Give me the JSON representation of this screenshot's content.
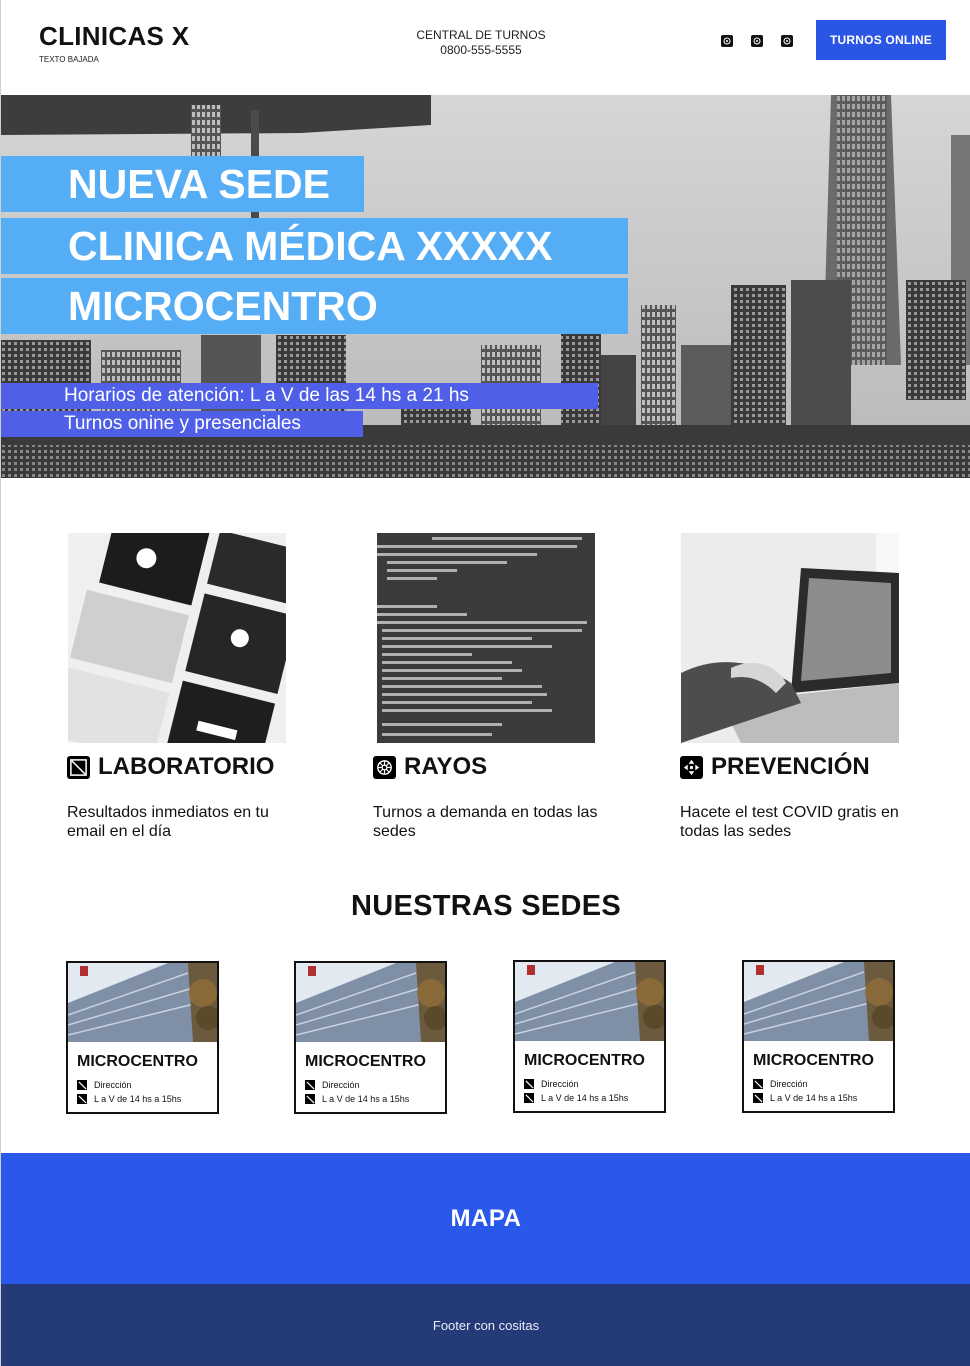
{
  "header": {
    "brand": "CLINICAS X",
    "tagline": "TEXTO BAJADA",
    "central_label": "CENTRAL DE TURNOS",
    "central_phone": "0800-555-5555",
    "social_icons": [
      "social-icon",
      "social-icon",
      "social-icon"
    ],
    "cta_label": "TURNOS ONLINE",
    "cta_color": "#2a55e5"
  },
  "hero": {
    "line1": "NUEVA SEDE",
    "line2": "CLINICA MÉDICA XXXXX",
    "line3": "MICROCENTRO",
    "hours": "Horarios de atención: L a V de las 14 hs a 21 hs",
    "turnos": "Turnos onine y presenciales",
    "band_color": "#55adf6",
    "sub_band_color": "#4f5fe8"
  },
  "services": [
    {
      "title": "LABORATORIO",
      "desc": "Resultados inmediatos en tu email en el día",
      "icon": "slash-square-icon"
    },
    {
      "title": "RAYOS",
      "desc": "Turnos a demanda en todas las sedes",
      "icon": "aperture-icon"
    },
    {
      "title": "PREVENCIÓN",
      "desc": "Hacete el test COVID gratis en todas las sedes",
      "icon": "move-arrows-icon"
    }
  ],
  "sedes": {
    "title": "NUESTRAS SEDES",
    "cards": [
      {
        "name": "MICROCENTRO",
        "address": "Dirección",
        "hours": "L a V de 14 hs a 15hs"
      },
      {
        "name": "MICROCENTRO",
        "address": "Dirección",
        "hours": "L a V de 14 hs a 15hs"
      },
      {
        "name": "MICROCENTRO",
        "address": "Dirección",
        "hours": "L a V de 14 hs a 15hs"
      },
      {
        "name": "MICROCENTRO",
        "address": "Dirección",
        "hours": "L a V de 14 hs a 15hs"
      }
    ]
  },
  "map": {
    "label": "MAPA",
    "color": "#2a58ea"
  },
  "footer": {
    "text": "Footer con cositas",
    "color": "#253b78"
  }
}
